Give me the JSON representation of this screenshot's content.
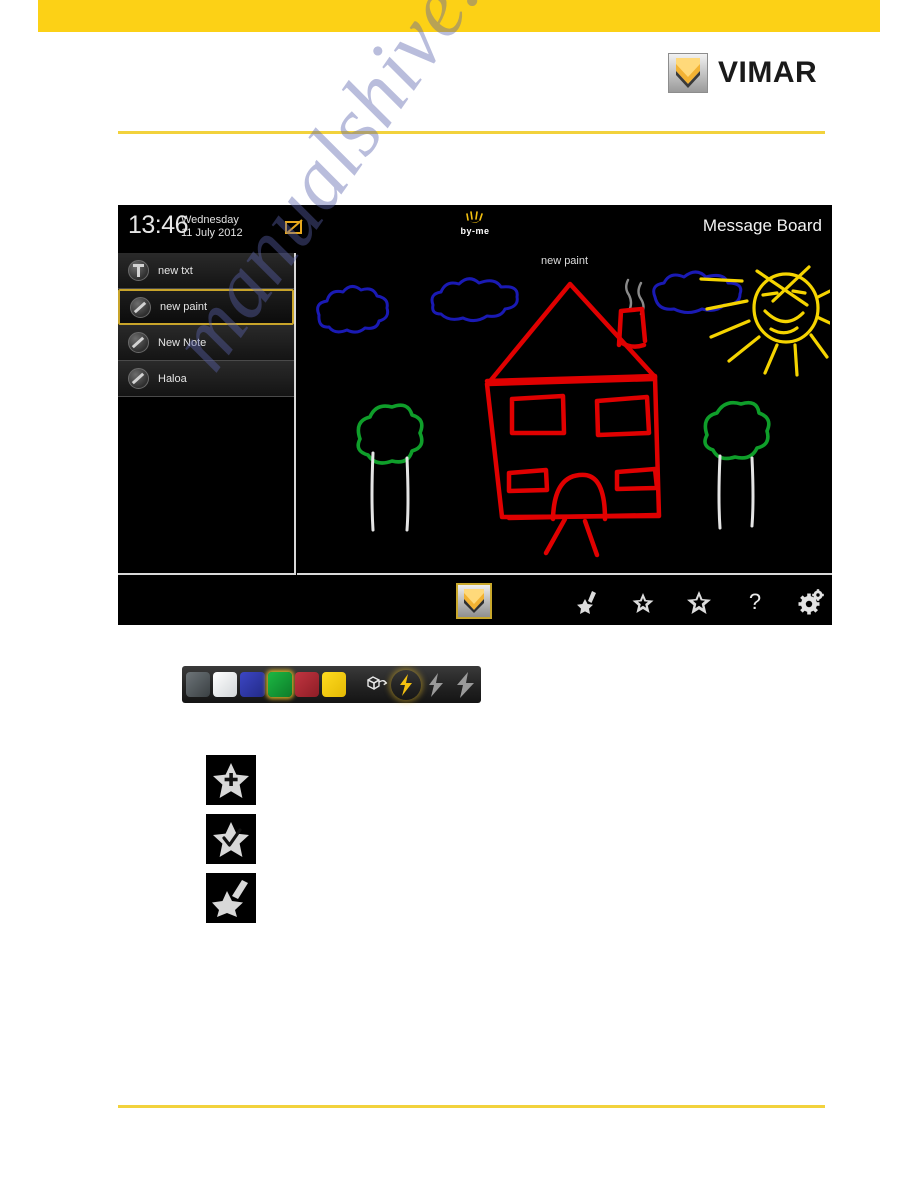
{
  "page": {
    "banner_color": "#fcd116",
    "rule_color": "#f2d23c",
    "watermark_text": "manualshive.com"
  },
  "brand": {
    "name": "VIMAR",
    "logo_icon": "vimar-shield-icon"
  },
  "device": {
    "statusbar": {
      "time": "13:46",
      "day": "Wednesday",
      "date": "11 July 2012",
      "status_icon": "edit-note-icon",
      "byme_logo_text": "by-me",
      "byme_icon": "byme-hand-icon",
      "screen_title": "Message Board"
    },
    "sidebar": {
      "items": [
        {
          "label": "new txt",
          "icon": "text-note-icon",
          "selected": false
        },
        {
          "label": "new paint",
          "icon": "paint-note-icon",
          "selected": true
        },
        {
          "label": "New Note",
          "icon": "paint-note-icon",
          "selected": false
        },
        {
          "label": "Haloa",
          "icon": "paint-note-icon",
          "selected": false
        }
      ]
    },
    "canvas": {
      "title": "new paint",
      "background": "#000000",
      "drawing_description": "child-style drawing: red house with windows, door and chimney with grey smoke, two blue clouds at left, one blue cloud at right, yellow smiling sun, two green trees with white trunks",
      "stroke_colors": {
        "house": "#e00000",
        "clouds": "#1a1ab4",
        "sun": "#f5d400",
        "trees": "#0f9e2a",
        "trunks": "#e4e4e4",
        "smoke": "#8a8a8a"
      }
    },
    "appbar": {
      "home_icon": "vimar-home-icon",
      "tools": [
        {
          "icon": "star-pencil-icon",
          "name": "edit-note-tool"
        },
        {
          "icon": "star-small-icon",
          "name": "star-small-tool"
        },
        {
          "icon": "star-large-icon",
          "name": "star-large-tool"
        },
        {
          "icon": "help-icon",
          "name": "help-tool",
          "glyph": "?"
        },
        {
          "icon": "gear-icon",
          "name": "settings-tool"
        }
      ]
    }
  },
  "palette": {
    "colors": [
      {
        "name": "dark-grey",
        "hex": "#4f5558",
        "selected": false
      },
      {
        "name": "white",
        "hex": "#e8eaec",
        "selected": false
      },
      {
        "name": "blue",
        "hex": "#2f37a8",
        "selected": false
      },
      {
        "name": "green",
        "hex": "#159a36",
        "selected": true
      },
      {
        "name": "red",
        "hex": "#ad2832",
        "selected": false
      },
      {
        "name": "yellow",
        "hex": "#f5cc10",
        "selected": false
      }
    ],
    "tools": [
      {
        "name": "eraser-tool",
        "icon": "eraser-icon",
        "selected": false
      },
      {
        "name": "stroke-thin-tool",
        "icon": "lightning-bolt-icon",
        "selected": true,
        "color": "#f2c010"
      },
      {
        "name": "stroke-medium-tool",
        "icon": "lightning-bolt-icon",
        "selected": false,
        "color": "#9a9a9a"
      },
      {
        "name": "stroke-thick-tool",
        "icon": "lightning-bolt-icon",
        "selected": false,
        "color": "#9a9a9a"
      }
    ]
  },
  "legend": {
    "items": [
      {
        "name": "star-plus-icon",
        "icon": "star-plus-icon"
      },
      {
        "name": "star-check-icon",
        "icon": "star-check-icon"
      },
      {
        "name": "star-pencil-icon",
        "icon": "star-pencil-icon"
      }
    ]
  }
}
